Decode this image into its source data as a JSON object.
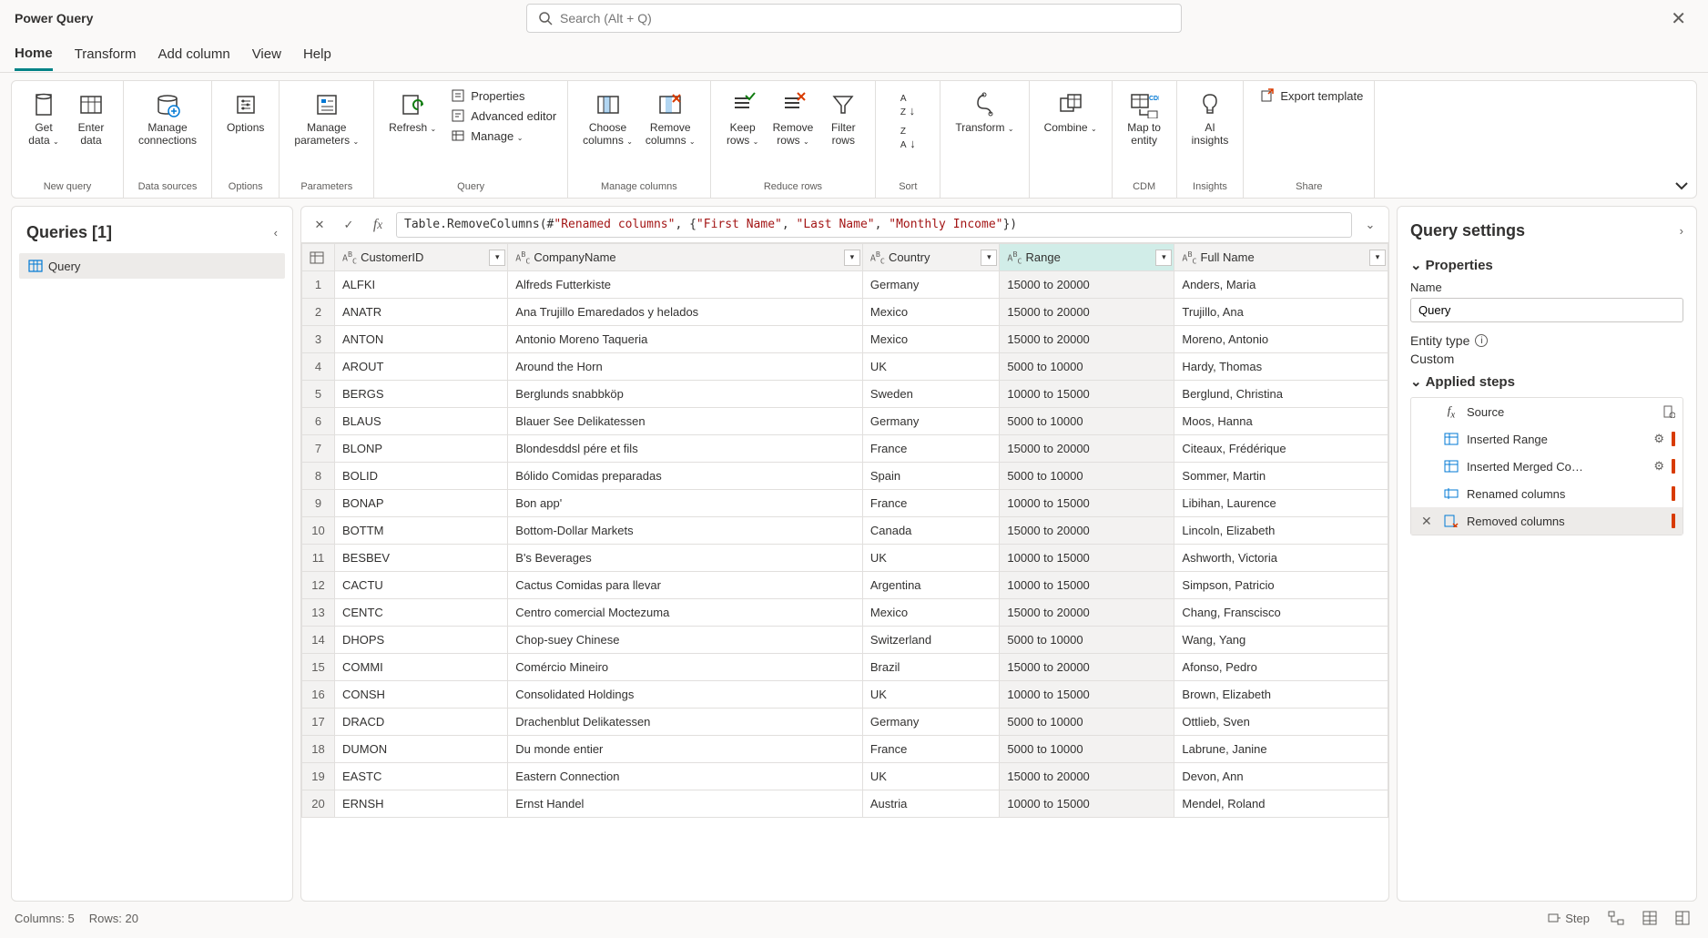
{
  "app": {
    "title": "Power Query"
  },
  "search": {
    "placeholder": "Search (Alt + Q)"
  },
  "menu": {
    "items": [
      {
        "label": "Home",
        "active": true
      },
      {
        "label": "Transform"
      },
      {
        "label": "Add column"
      },
      {
        "label": "View"
      },
      {
        "label": "Help"
      }
    ]
  },
  "ribbon": {
    "groups": [
      {
        "label": "New query",
        "buttons": [
          {
            "label": "Get\ndata",
            "dropdown": true,
            "icon": "get-data"
          },
          {
            "label": "Enter\ndata",
            "icon": "enter-data"
          }
        ]
      },
      {
        "label": "Data sources",
        "buttons": [
          {
            "label": "Manage\nconnections",
            "icon": "connections"
          }
        ]
      },
      {
        "label": "Options",
        "buttons": [
          {
            "label": "Options",
            "icon": "options"
          }
        ]
      },
      {
        "label": "Parameters",
        "buttons": [
          {
            "label": "Manage\nparameters",
            "dropdown": true,
            "icon": "parameters"
          }
        ]
      },
      {
        "label": "Query",
        "buttons": [
          {
            "label": "Refresh",
            "dropdown": true,
            "icon": "refresh"
          }
        ],
        "stack": [
          {
            "label": "Properties",
            "icon": "props"
          },
          {
            "label": "Advanced editor",
            "icon": "adv-editor"
          },
          {
            "label": "Manage",
            "dropdown": true,
            "icon": "manage"
          }
        ]
      },
      {
        "label": "Manage columns",
        "buttons": [
          {
            "label": "Choose\ncolumns",
            "dropdown": true,
            "icon": "choose-cols"
          },
          {
            "label": "Remove\ncolumns",
            "dropdown": true,
            "icon": "remove-cols"
          }
        ]
      },
      {
        "label": "Reduce rows",
        "buttons": [
          {
            "label": "Keep\nrows",
            "dropdown": true,
            "icon": "keep-rows"
          },
          {
            "label": "Remove\nrows",
            "dropdown": true,
            "icon": "remove-rows"
          },
          {
            "label": "Filter\nrows",
            "icon": "filter"
          }
        ]
      },
      {
        "label": "Sort",
        "buttons": [
          {
            "label": "",
            "icon": "sort",
            "stackicons": true
          }
        ]
      },
      {
        "label": "",
        "buttons": [
          {
            "label": "Transform",
            "dropdown": true,
            "icon": "transform"
          }
        ]
      },
      {
        "label": "",
        "buttons": [
          {
            "label": "Combine",
            "dropdown": true,
            "icon": "combine"
          }
        ]
      },
      {
        "label": "CDM",
        "buttons": [
          {
            "label": "Map to\nentity",
            "icon": "cdm"
          }
        ]
      },
      {
        "label": "Insights",
        "buttons": [
          {
            "label": "AI\ninsights",
            "icon": "ai"
          }
        ]
      },
      {
        "label": "Share",
        "stack": [
          {
            "label": "Export template",
            "icon": "export"
          }
        ]
      }
    ]
  },
  "queries": {
    "title": "Queries [1]",
    "items": [
      {
        "label": "Query"
      }
    ]
  },
  "formula": {
    "prefix": "Table.RemoveColumns(#",
    "step": "\"Renamed columns\"",
    "mid": ", {",
    "args": [
      "\"First Name\"",
      "\"Last Name\"",
      "\"Monthly Income\""
    ],
    "suffix": "})"
  },
  "table": {
    "columns": [
      {
        "name": "CustomerID",
        "type": "ABC"
      },
      {
        "name": "CompanyName",
        "type": "ABC"
      },
      {
        "name": "Country",
        "type": "ABC"
      },
      {
        "name": "Range",
        "type": "ABC",
        "selected": true
      },
      {
        "name": "Full Name",
        "type": "ABC"
      }
    ],
    "rows": [
      [
        "ALFKI",
        "Alfreds Futterkiste",
        "Germany",
        "15000 to 20000",
        "Anders, Maria"
      ],
      [
        "ANATR",
        "Ana Trujillo Emaredados y helados",
        "Mexico",
        "15000 to 20000",
        "Trujillo, Ana"
      ],
      [
        "ANTON",
        "Antonio Moreno Taqueria",
        "Mexico",
        "15000 to 20000",
        "Moreno, Antonio"
      ],
      [
        "AROUT",
        "Around the Horn",
        "UK",
        "5000 to 10000",
        "Hardy, Thomas"
      ],
      [
        "BERGS",
        "Berglunds snabbköp",
        "Sweden",
        "10000 to 15000",
        "Berglund, Christina"
      ],
      [
        "BLAUS",
        "Blauer See Delikatessen",
        "Germany",
        "5000 to 10000",
        "Moos, Hanna"
      ],
      [
        "BLONP",
        "Blondesddsl pére et fils",
        "France",
        "15000 to 20000",
        "Citeaux, Frédérique"
      ],
      [
        "BOLID",
        "Bólido Comidas preparadas",
        "Spain",
        "5000 to 10000",
        "Sommer, Martin"
      ],
      [
        "BONAP",
        "Bon app'",
        "France",
        "10000 to 15000",
        "Libihan, Laurence"
      ],
      [
        "BOTTM",
        "Bottom-Dollar Markets",
        "Canada",
        "15000 to 20000",
        "Lincoln, Elizabeth"
      ],
      [
        "BESBEV",
        "B's Beverages",
        "UK",
        "10000 to 15000",
        "Ashworth, Victoria"
      ],
      [
        "CACTU",
        "Cactus Comidas para llevar",
        "Argentina",
        "10000 to 15000",
        "Simpson, Patricio"
      ],
      [
        "CENTC",
        "Centro comercial Moctezuma",
        "Mexico",
        "15000 to 20000",
        "Chang, Franscisco"
      ],
      [
        "DHOPS",
        "Chop-suey Chinese",
        "Switzerland",
        "5000 to 10000",
        "Wang, Yang"
      ],
      [
        "COMMI",
        "Comércio Mineiro",
        "Brazil",
        "15000 to 20000",
        "Afonso, Pedro"
      ],
      [
        "CONSH",
        "Consolidated Holdings",
        "UK",
        "10000 to 15000",
        "Brown, Elizabeth"
      ],
      [
        "DRACD",
        "Drachenblut Delikatessen",
        "Germany",
        "5000 to 10000",
        "Ottlieb, Sven"
      ],
      [
        "DUMON",
        "Du monde entier",
        "France",
        "5000 to 10000",
        "Labrune, Janine"
      ],
      [
        "EASTC",
        "Eastern Connection",
        "UK",
        "15000 to 20000",
        "Devon, Ann"
      ],
      [
        "ERNSH",
        "Ernst Handel",
        "Austria",
        "10000 to 15000",
        "Mendel, Roland"
      ]
    ]
  },
  "settings": {
    "title": "Query settings",
    "properties_label": "Properties",
    "name_label": "Name",
    "name_value": "Query",
    "entity_label": "Entity type",
    "entity_value": "Custom",
    "steps_label": "Applied steps",
    "steps": [
      {
        "label": "Source",
        "icon": "fx",
        "gear": false,
        "doc": true
      },
      {
        "label": "Inserted Range",
        "icon": "table",
        "gear": true,
        "bar": "red"
      },
      {
        "label": "Inserted Merged Co…",
        "icon": "table",
        "gear": true,
        "bar": "red"
      },
      {
        "label": "Renamed columns",
        "icon": "rename",
        "bar": "red"
      },
      {
        "label": "Removed columns",
        "icon": "remove",
        "active": true,
        "bar": "red",
        "x": true
      }
    ]
  },
  "status": {
    "columns": "Columns: 5",
    "rows": "Rows: 20",
    "step": "Step"
  }
}
